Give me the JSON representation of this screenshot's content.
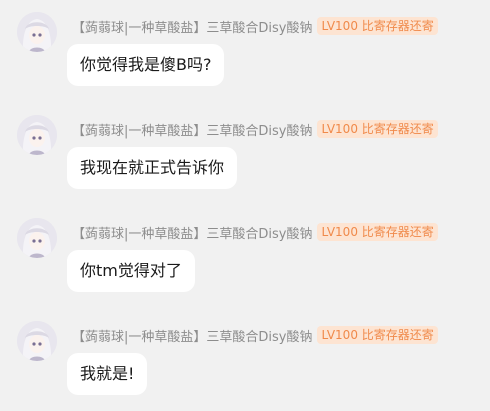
{
  "messages": [
    {
      "sender": "【蒟蒻球|一种草酸盐】三草酸合Disy酸钠",
      "title": "LV100 比寄存器还寄",
      "text": "你觉得我是傻B吗?"
    },
    {
      "sender": "【蒟蒻球|一种草酸盐】三草酸合Disy酸钠",
      "title": "LV100 比寄存器还寄",
      "text": "我现在就正式告诉你"
    },
    {
      "sender": "【蒟蒻球|一种草酸盐】三草酸合Disy酸钠",
      "title": "LV100 比寄存器还寄",
      "text": "你tm觉得对了"
    },
    {
      "sender": "【蒟蒻球|一种草酸盐】三草酸合Disy酸钠",
      "title": "LV100 比寄存器还寄",
      "text": "我就是!"
    }
  ]
}
